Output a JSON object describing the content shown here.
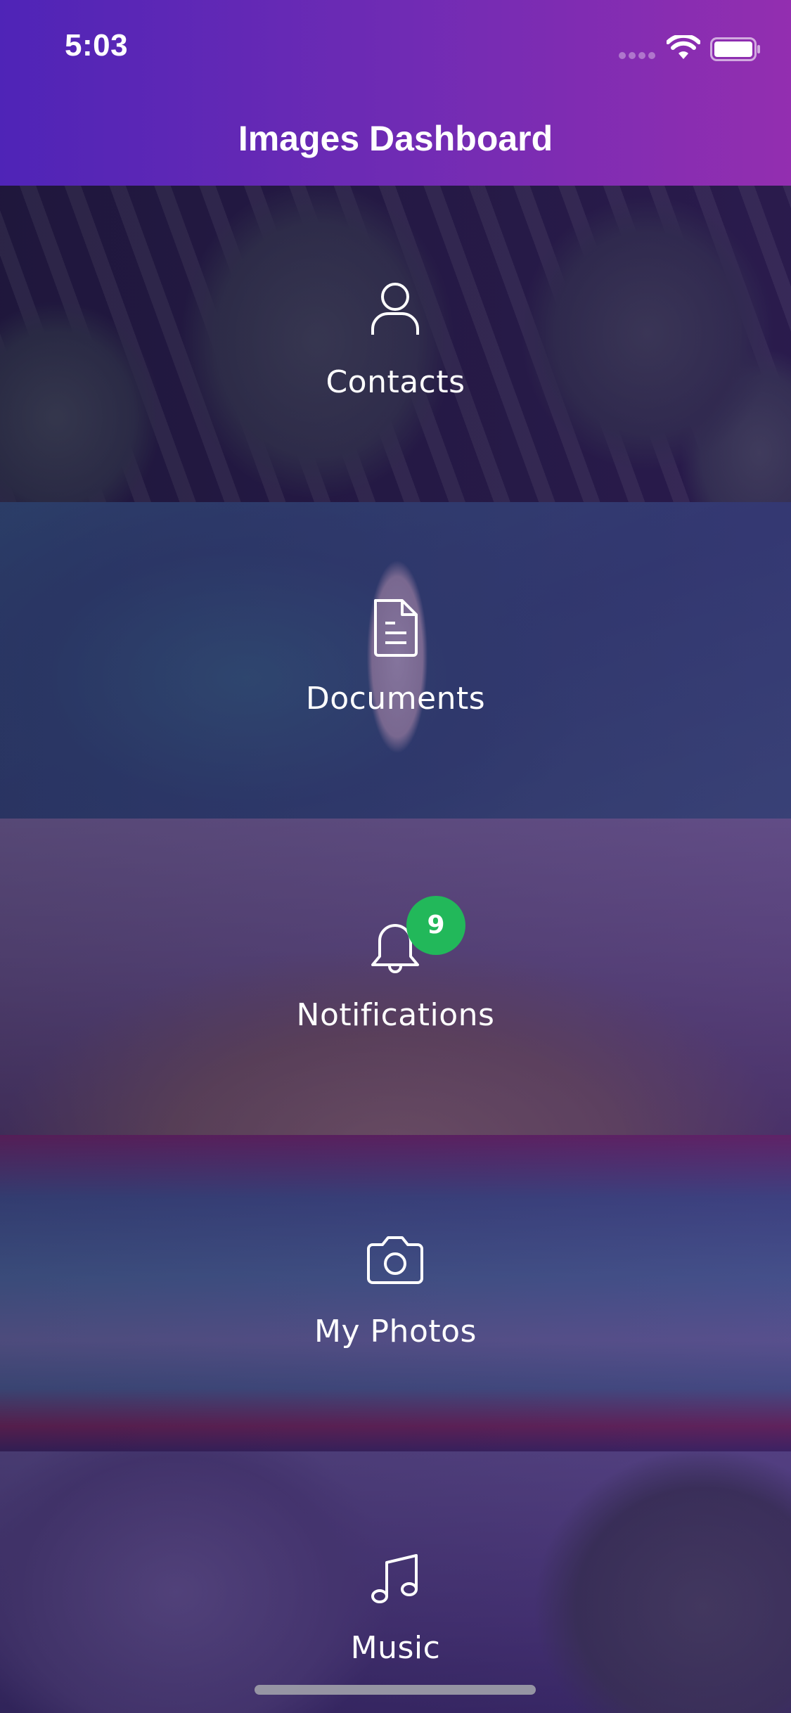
{
  "status_bar": {
    "time": "5:03"
  },
  "nav": {
    "title": "Images Dashboard"
  },
  "tiles": [
    {
      "label": "Contacts",
      "icon": "person-icon"
    },
    {
      "label": "Documents",
      "icon": "document-icon"
    },
    {
      "label": "Notifications",
      "icon": "bell-icon",
      "badge": "9"
    },
    {
      "label": "My Photos",
      "icon": "camera-icon"
    },
    {
      "label": "Music",
      "icon": "music-note-icon"
    }
  ],
  "colors": {
    "header_gradient_start": "#4f24b7",
    "header_gradient_end": "#932eb0",
    "badge": "#22b85a",
    "text": "#ffffff"
  }
}
